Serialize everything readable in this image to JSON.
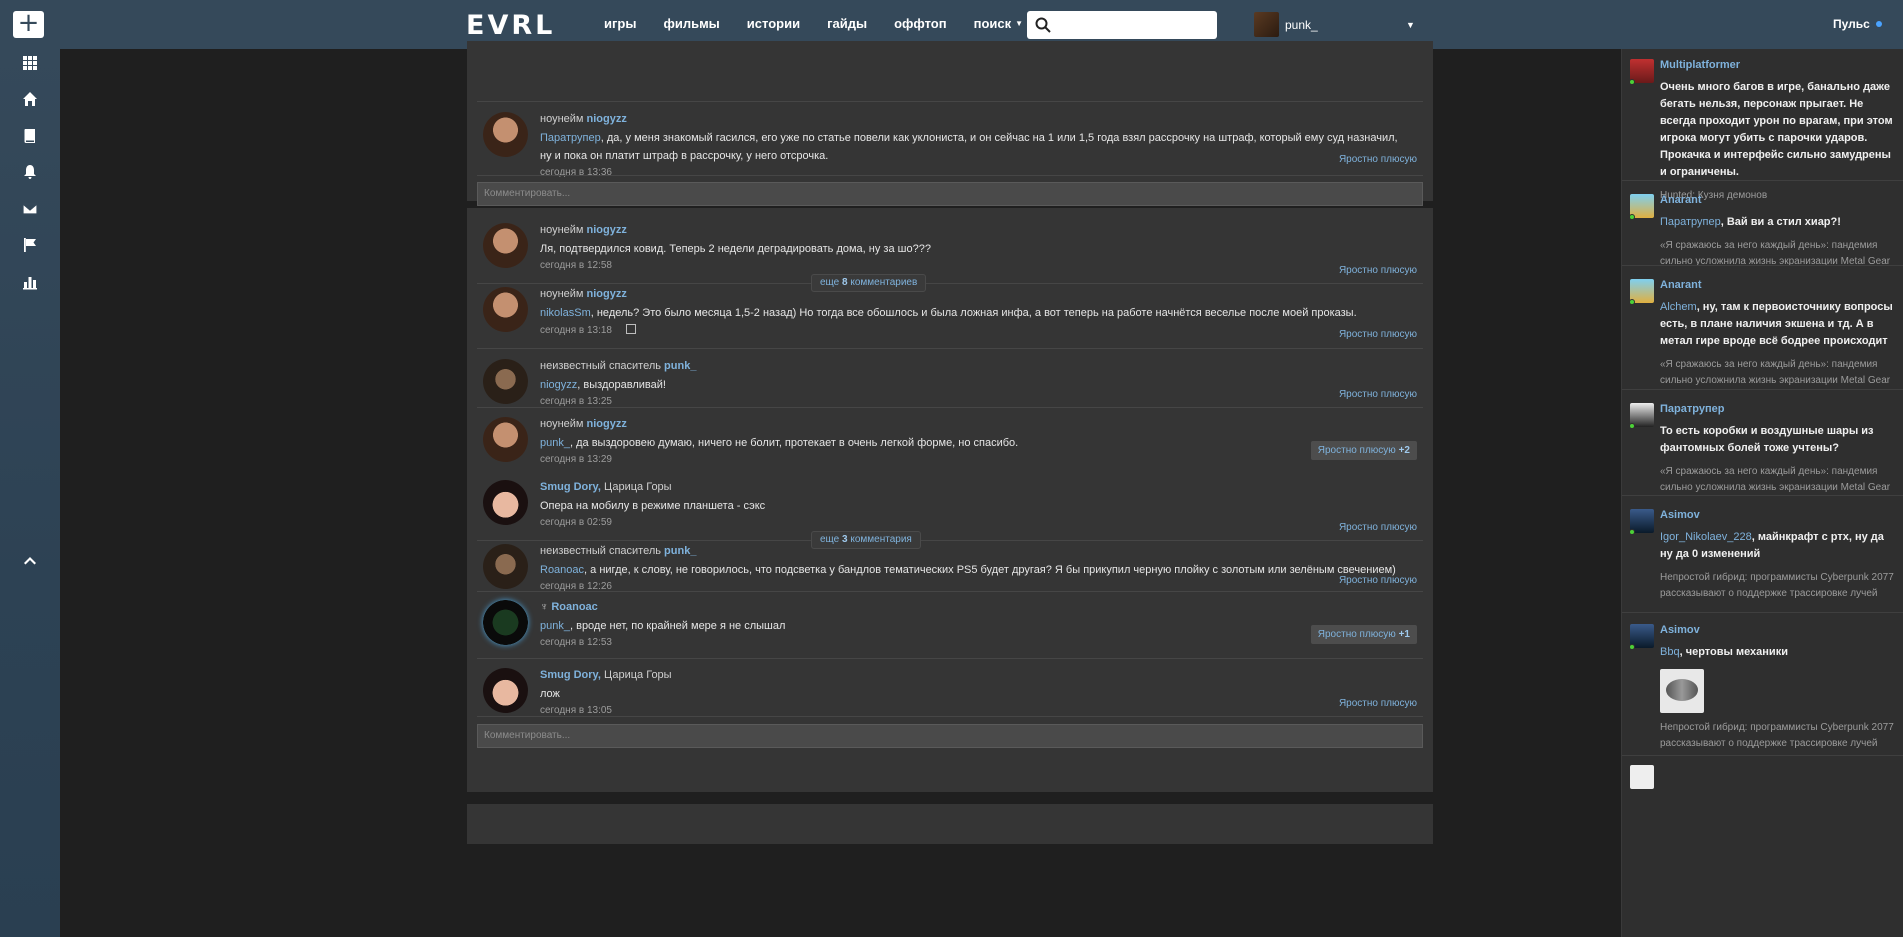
{
  "topbar": {
    "add_label": "+",
    "logo": "EVRL",
    "nav": [
      "игры",
      "фильмы",
      "истории",
      "гайды",
      "оффтоп"
    ],
    "search_menu": "поиск",
    "search_placeholder": "",
    "username": "punk_",
    "pulse": "Пульс"
  },
  "sidebar_icons": [
    "grid-icon",
    "home-icon",
    "book-icon",
    "bell-icon",
    "mail-icon",
    "flag-icon",
    "stats-icon",
    "chevron-up-icon"
  ],
  "feed": {
    "comment_placeholder": "Комментировать...",
    "like_label": "Яростно плюсую",
    "card1": {
      "c1": {
        "prefix": "ноунейм",
        "user": "niogyzz",
        "mention": "Паратрупер",
        "text": ", да, у меня знакомый гасился, его уже по статье повели как уклониста, и он сейчас на 1 или 1,5 года взял рассрочку на штраф, который ему суд назначил, ну и пока он платит штраф в рассрочку, у него отсрочка.",
        "time": "сегодня в 13:36"
      }
    },
    "card2": {
      "c1": {
        "prefix": "ноунейм",
        "user": "niogyzz",
        "text": "Ля, подтвердился ковид. Теперь 2 недели деградировать дома, ну за шо???",
        "time": "сегодня в 12:58"
      },
      "more_prefix": "еще",
      "more_count": "8",
      "more_suffix": "комментариев",
      "c2": {
        "prefix": "ноунейм",
        "user": "niogyzz",
        "mention": "nikolasSm",
        "text": ", недель? Это было месяца 1,5-2 назад) Но тогда все обошлось и была ложная инфа, а вот теперь на работе начнётся веселье после моей проказы.",
        "time": "сегодня в 13:18"
      },
      "c3": {
        "prefix": "неизвестный спаситель",
        "user": "punk_",
        "mention": "niogyzz",
        "text": ", выздоравливай!",
        "time": "сегодня в 13:25"
      },
      "c4": {
        "prefix": "ноунейм",
        "user": "niogyzz",
        "mention": "punk_",
        "text": ", да выздоровею думаю, ничего не болит, протекает в очень легкой форме, но спасибо.",
        "time": "сегодня в 13:29",
        "plus": "+2"
      }
    },
    "card3": {
      "c1": {
        "user": "Smug Dory,",
        "suffix": "Царица Горы",
        "text": "Опера на мобилу в режиме планшета - сэкс",
        "time": "сегодня в 02:59"
      },
      "more_prefix": "еще",
      "more_count": "3",
      "more_suffix": "комментария",
      "c2": {
        "prefix": "неизвестный спаситель",
        "user": "punk_",
        "mention": "Roanoac",
        "text": ", а нигде, к слову, не говорилось, что подсветка у бандлов тематических PS5 будет другая? Я бы прикупил черную плойку с золотым или зелёным свечением)",
        "time": "сегодня в 12:26"
      },
      "c3": {
        "user": "Roanoac",
        "mention": "punk_",
        "text": ", вроде нет, по крайней мере я не слышал",
        "time": "сегодня в 12:53",
        "plus": "+1"
      },
      "c4": {
        "user": "Smug Dory,",
        "suffix": "Царица Горы",
        "text": "лож",
        "time": "сегодня в 13:05"
      }
    }
  },
  "pulse_feed": [
    {
      "name": "Multiplatformer",
      "mention": "",
      "text": "Очень много багов в игре, банально даже бегать нельзя, персонаж прыгает. Не всегда проходит урон по врагам, при этом игрока могут убить с парочки ударов. Прокачка и интерфейс сильно замудрены и ограничены.",
      "source": "Hunted: Кузня демонов"
    },
    {
      "name": "Anarant",
      "mention": "Паратрупер",
      "text": ", Вай ви а стил хиар?!",
      "source": "«Я сражаюсь за него каждый день»: пандемия сильно усложнила жизнь экранизации Metal Gear"
    },
    {
      "name": "Anarant",
      "mention": "Alchem",
      "text": ", ну, там к первоисточнику вопросы есть, в плане наличия экшена и тд. А в метал гире вроде всё бодрее происходит",
      "source": "«Я сражаюсь за него каждый день»: пандемия сильно усложнила жизнь экранизации Metal Gear"
    },
    {
      "name": "Паратрупер",
      "mention": "",
      "text": "То есть коробки и воздушные шары из фантомных болей тоже учтены?",
      "source": "«Я сражаюсь за него каждый день»: пандемия сильно усложнила жизнь экранизации Metal Gear"
    },
    {
      "name": "Asimov",
      "mention": "Igor_Nikolaev_228",
      "text": ", майнкрафт с ртх, ну да ну да 0 изменений",
      "source": "Непростой гибрид: программисты Cyberpunk 2077 рассказывают о поддержке трассировке лучей"
    },
    {
      "name": "Asimov",
      "mention": "Bbq",
      "text": ", чертовы механики",
      "source": "Непростой гибрид: программисты Cyberpunk 2077 рассказывают о поддержке трассировке лучей"
    }
  ]
}
